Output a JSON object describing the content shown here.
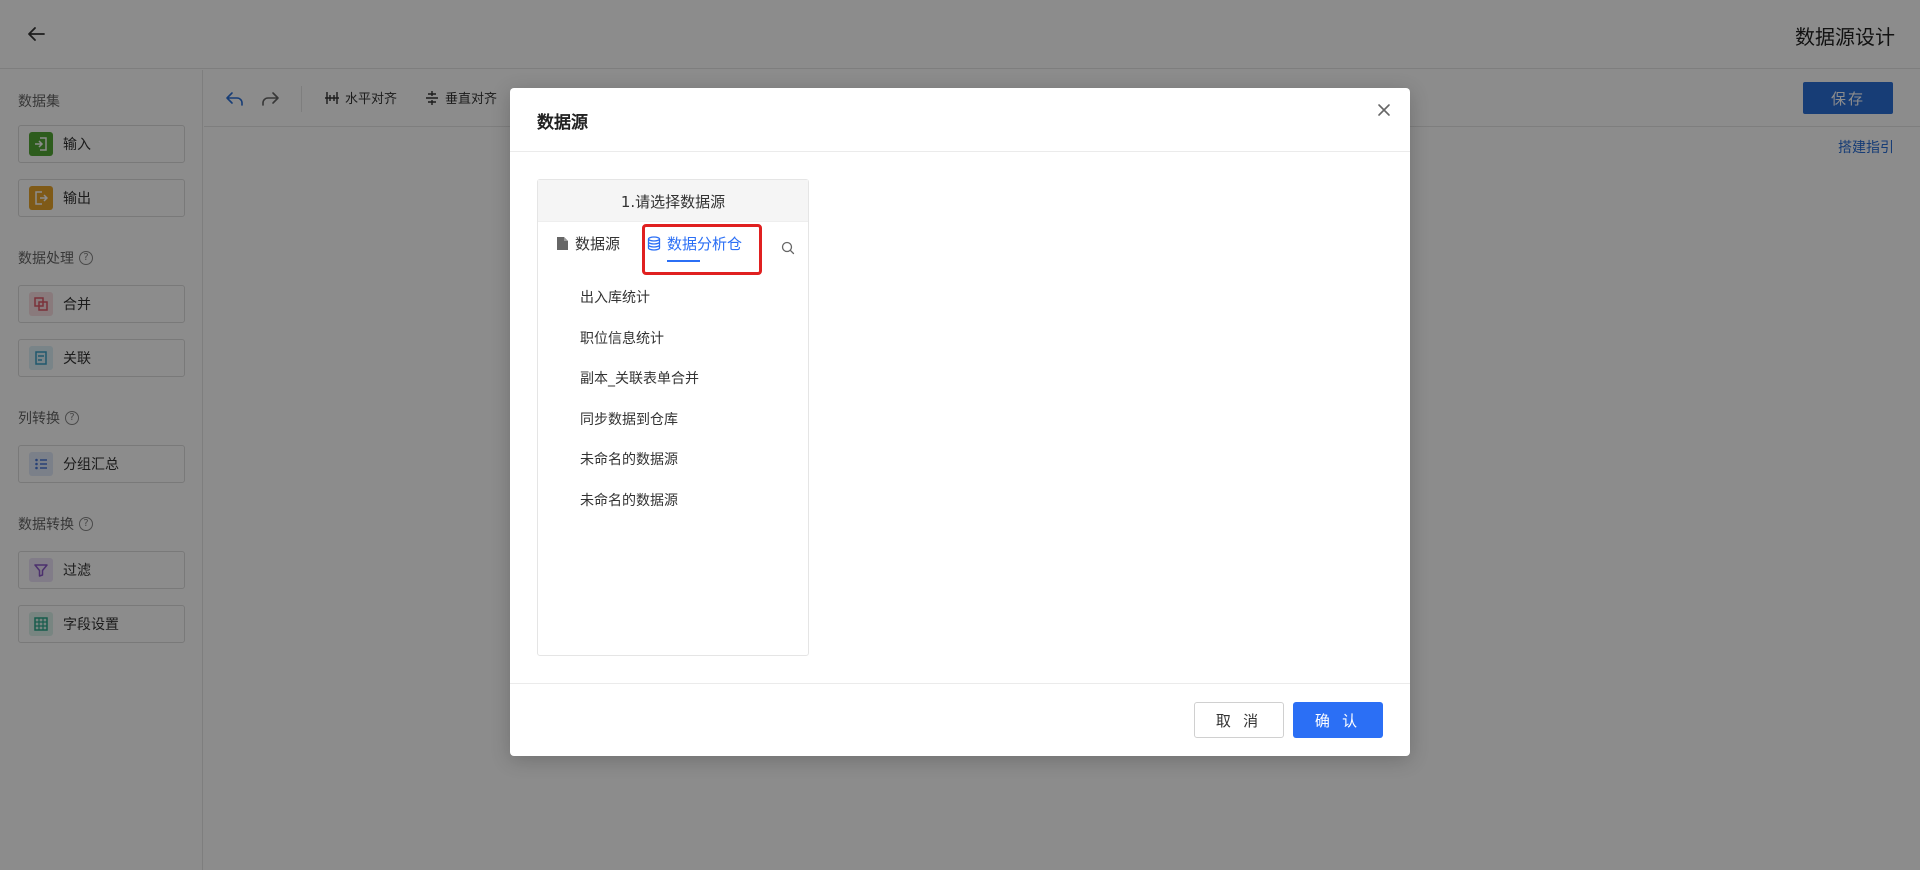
{
  "header": {
    "title": "数据源设计"
  },
  "sidebar": {
    "groups": [
      {
        "title": "数据集",
        "items": [
          {
            "label": "输入",
            "icon": "input-icon",
            "color": "#52a836"
          },
          {
            "label": "输出",
            "icon": "output-icon",
            "color": "#e8a52a"
          }
        ]
      },
      {
        "title": "数据处理",
        "help": true,
        "items": [
          {
            "label": "合并",
            "icon": "merge-icon",
            "color": "#e05a6a"
          },
          {
            "label": "关联",
            "icon": "join-icon",
            "color": "#3aa0c8"
          }
        ]
      },
      {
        "title": "列转换",
        "help": true,
        "items": [
          {
            "label": "分组汇总",
            "icon": "group-summary-icon",
            "color": "#4a78d8"
          }
        ]
      },
      {
        "title": "数据转换",
        "help": true,
        "items": [
          {
            "label": "过滤",
            "icon": "filter-icon",
            "color": "#8a58c8"
          },
          {
            "label": "字段设置",
            "icon": "field-settings-icon",
            "color": "#2aa88a"
          }
        ]
      }
    ]
  },
  "toolbar": {
    "h_align": "水平对齐",
    "v_align": "垂直对齐",
    "save": "保存",
    "guide": "搭建指引"
  },
  "modal": {
    "title": "数据源",
    "step": "1.请选择数据源",
    "tabs": {
      "datasource": "数据源",
      "warehouse": "数据分析仓"
    },
    "active_tab": "数据分析仓",
    "items": [
      "出入库统计",
      "职位信息统计",
      "副本_关联表单合并",
      "同步数据到仓库",
      "未命名的数据源",
      "未命名的数据源"
    ],
    "cancel": "取 消",
    "confirm": "确 认"
  },
  "colors": {
    "primary": "#2b6ff5",
    "highlight": "#e02020"
  }
}
